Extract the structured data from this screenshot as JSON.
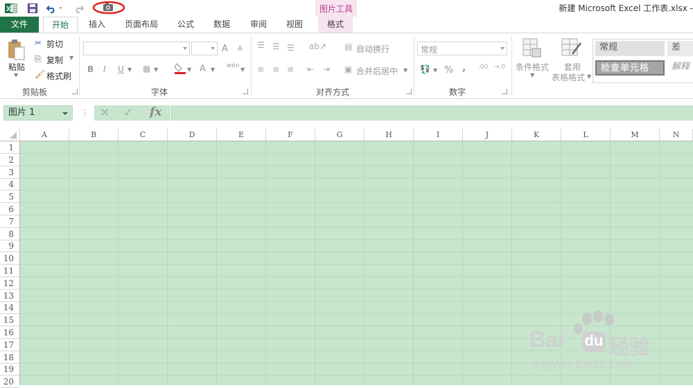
{
  "titlebar": {
    "title": "新建 Microsoft Excel 工作表.xlsx -",
    "context_group": "图片工具",
    "camera_highlight_color": "#e0201f"
  },
  "tabs": {
    "file": "文件",
    "home": "开始",
    "insert": "插入",
    "page_layout": "页面布局",
    "formulas": "公式",
    "data": "数据",
    "review": "审阅",
    "view": "视图",
    "format": "格式"
  },
  "ribbon": {
    "clipboard": {
      "paste": "粘贴",
      "cut": "剪切",
      "copy": "复制",
      "format_painter": "格式刷",
      "label": "剪贴板"
    },
    "font": {
      "label": "字体",
      "bold": "B",
      "italic": "I",
      "underline": "U",
      "grow": "A",
      "shrink": "A",
      "font_color": "A"
    },
    "alignment": {
      "wrap": "自动换行",
      "merge": "合并后居中",
      "label": "对齐方式"
    },
    "number": {
      "format": "常规",
      "percent": "%",
      "comma": ",",
      "label": "数字"
    },
    "styles": {
      "conditional": "条件格式",
      "table_format_1": "套用",
      "table_format_2": "表格格式",
      "normal": "常规",
      "bad": "差",
      "check_cell": "检查单元格",
      "explanatory": "解释"
    }
  },
  "formula_bar": {
    "name_box": "图片 1",
    "fx": "fx",
    "cancel": "✕",
    "enter": "✓"
  },
  "sheet": {
    "columns": [
      "A",
      "B",
      "C",
      "D",
      "E",
      "F",
      "G",
      "H",
      "I",
      "J",
      "K",
      "L",
      "M",
      "N"
    ],
    "rows": [
      "1",
      "2",
      "3",
      "4",
      "5",
      "6",
      "7",
      "8",
      "9",
      "10",
      "11",
      "12",
      "13",
      "14",
      "15",
      "16",
      "17",
      "18",
      "19",
      "20"
    ],
    "cell_fill": "#c7e6cd"
  },
  "watermark": {
    "brand_a": "Bai",
    "brand_b": "du",
    "brand_c": "经验",
    "url": "jingyan.baidu.com"
  }
}
